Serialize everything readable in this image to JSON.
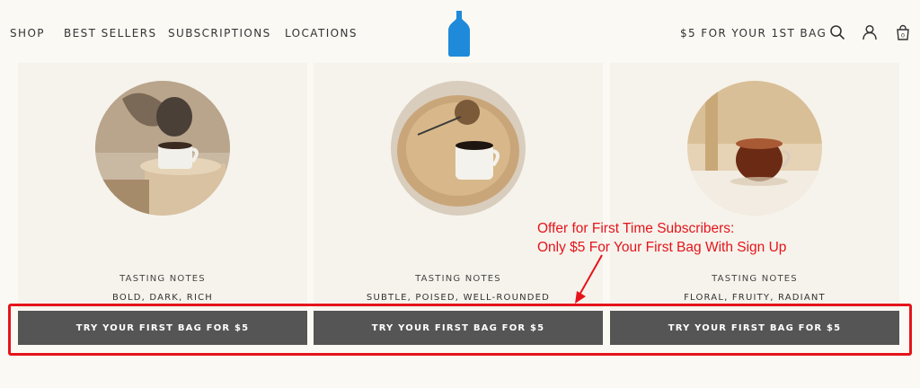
{
  "header": {
    "nav": [
      "SHOP",
      "BEST SELLERS",
      "SUBSCRIPTIONS",
      "LOCATIONS"
    ],
    "promo": "$5 FOR YOUR 1ST BAG",
    "icons": [
      "search-icon",
      "account-icon",
      "cart-icon"
    ],
    "cart_count": "0",
    "logo_color": "#1f8ad9"
  },
  "cards": [
    {
      "tasting_label": "TASTING NOTES",
      "notes": "BOLD, DARK, RICH",
      "button": "TRY YOUR FIRST BAG FOR $5"
    },
    {
      "tasting_label": "TASTING NOTES",
      "notes": "SUBTLE, POISED, WELL-ROUNDED",
      "button": "TRY YOUR FIRST BAG FOR $5"
    },
    {
      "tasting_label": "TASTING NOTES",
      "notes": "FLORAL, FRUITY, RADIANT",
      "button": "TRY YOUR FIRST BAG FOR $5"
    }
  ],
  "annotation": {
    "line1": "Offer for First Time Subscribers:",
    "line2": "Only $5 For Your First Bag With Sign Up",
    "color": "#e5141b"
  },
  "colors": {
    "background": "#fbf9f4",
    "card": "#f6f3ec",
    "button": "#555555"
  }
}
